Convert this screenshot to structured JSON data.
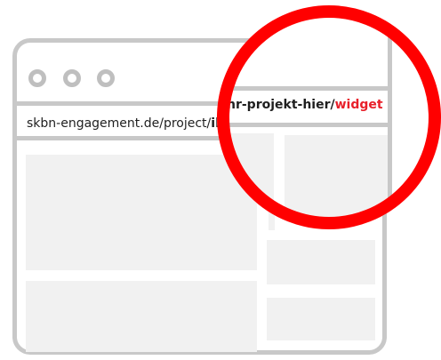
{
  "address_bar": {
    "url_prefix": "skbn-engagement.de/project/",
    "url_bold_start": "ihr"
  },
  "magnifier": {
    "url_part": "hr-projekt-hier/",
    "url_accent": "widget",
    "accent_color": "#e8202a",
    "ring_color": "#ff0000"
  }
}
